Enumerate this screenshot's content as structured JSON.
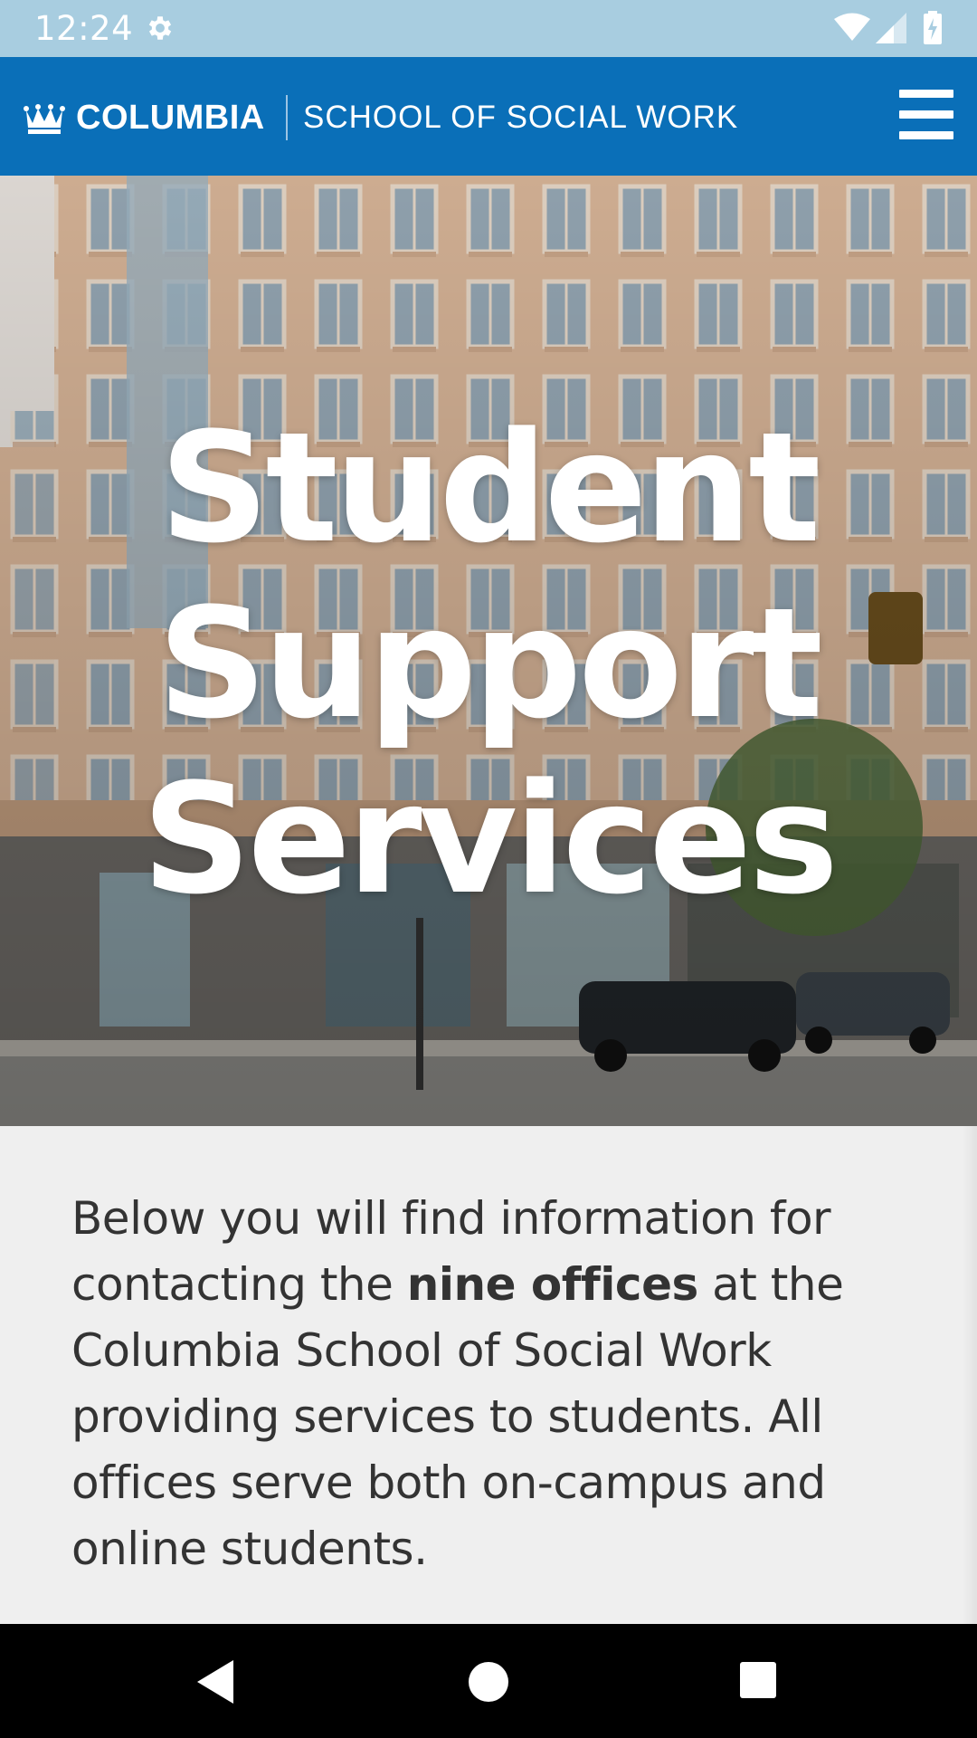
{
  "status_bar": {
    "time": "12:24",
    "icons": [
      "gear-icon",
      "wifi-icon",
      "signal-icon",
      "battery-icon"
    ]
  },
  "header": {
    "brand_name": "COLUMBIA",
    "school_name": "SCHOOL OF SOCIAL WORK",
    "menu_icon": "hamburger-menu-icon",
    "background_color": "#0a6fb8"
  },
  "hero": {
    "title_lines": [
      "Student",
      "Support",
      "Services"
    ],
    "image": "building-photo"
  },
  "intro": {
    "text_before": "Below you will find information for contacting the ",
    "text_bold": "nine offices",
    "text_after": " at the Columbia School of Social Work providing services to students. All offices serve both on-campus and online students."
  },
  "nav_bar": {
    "buttons": [
      "back-icon",
      "home-icon",
      "recents-icon"
    ]
  }
}
